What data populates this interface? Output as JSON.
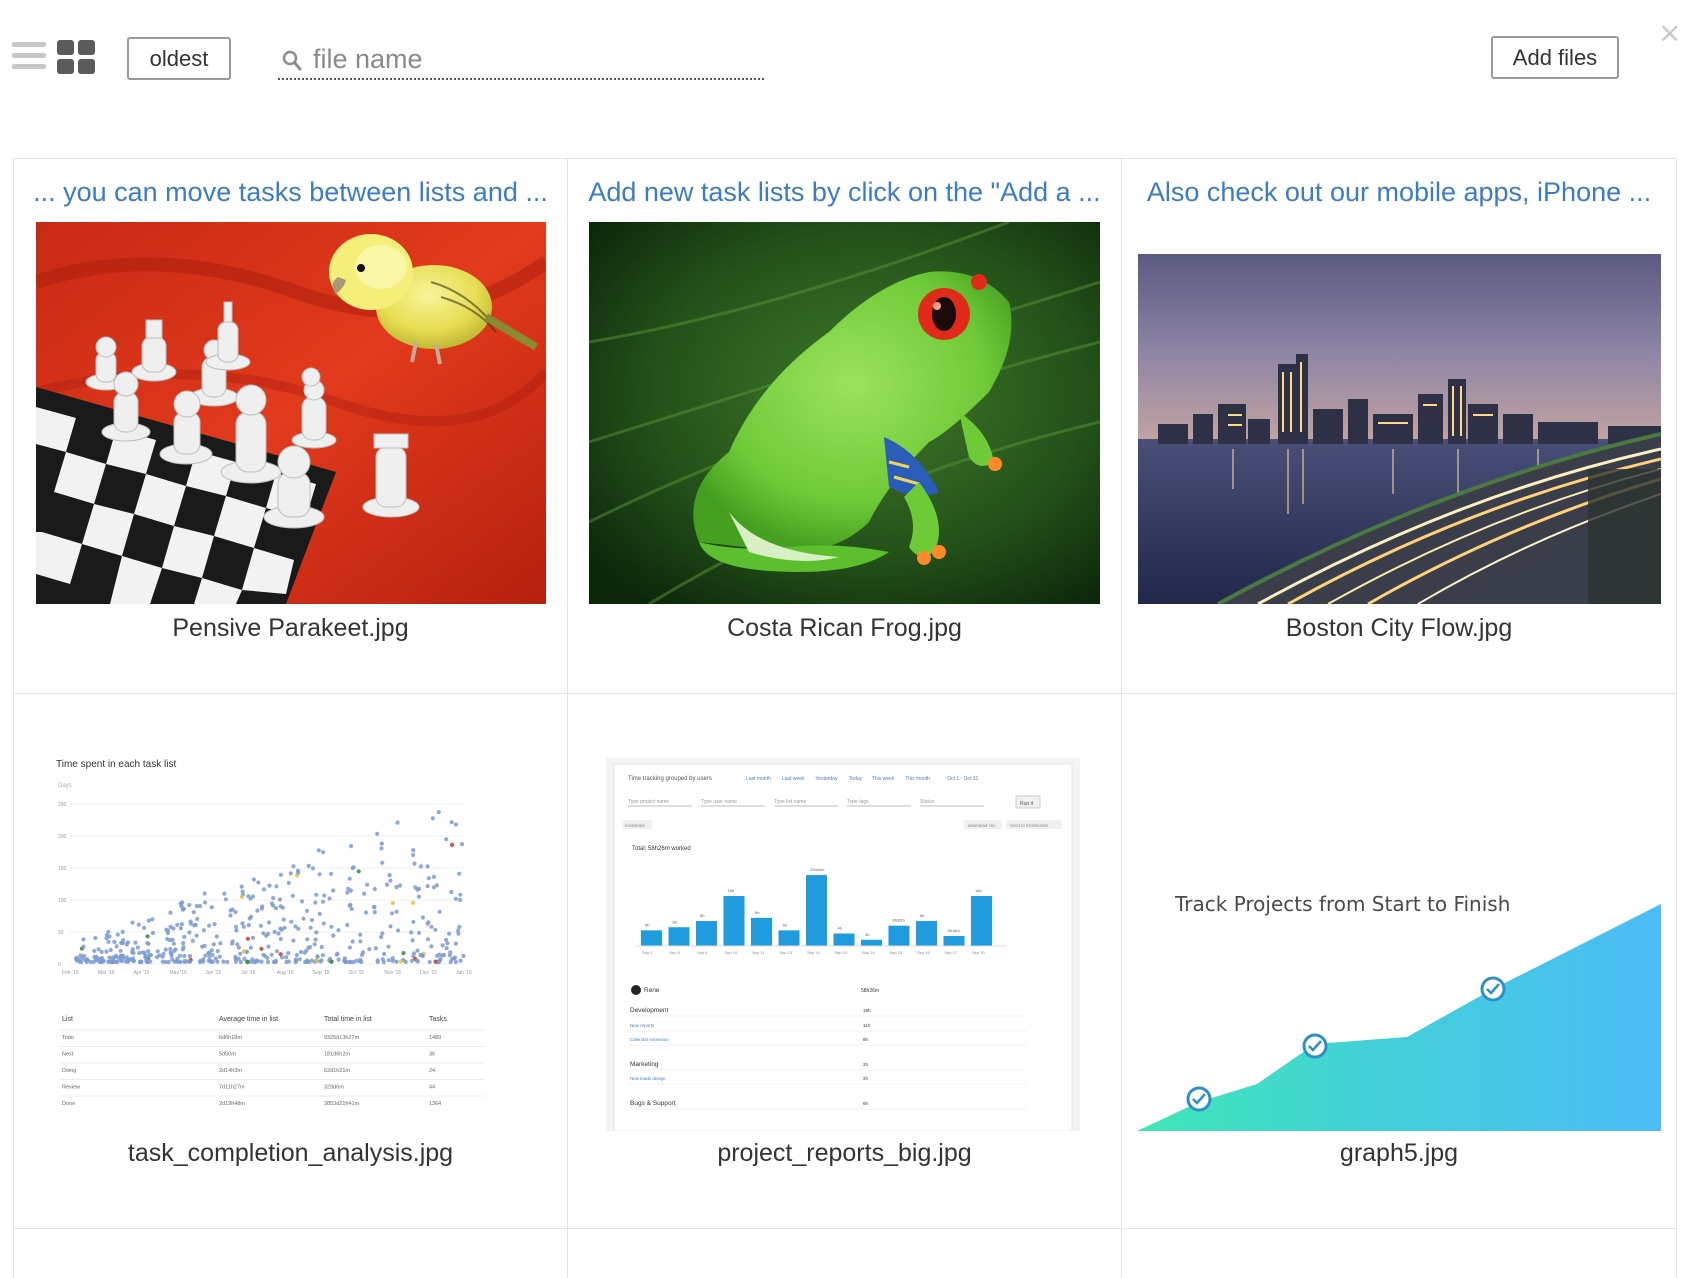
{
  "toolbar": {
    "sort_label": "oldest",
    "search_placeholder": "file name",
    "add_files_label": "Add files",
    "close_glyph": "×"
  },
  "files": [
    {
      "title": "... you can move tasks between lists and ...",
      "name": "Pensive Parakeet.jpg",
      "thumb": "parakeet-chess-photo"
    },
    {
      "title": "Add new task lists by click on the \"Add a ...",
      "name": "Costa Rican Frog.jpg",
      "thumb": "green-frog-photo"
    },
    {
      "title": "Also check out our mobile apps, iPhone ...",
      "name": "Boston City Flow.jpg",
      "thumb": "boston-skyline-photo"
    },
    {
      "title": "",
      "name": "task_completion_analysis.jpg",
      "thumb": "scatter-report-screenshot"
    },
    {
      "title": "",
      "name": "project_reports_big.jpg",
      "thumb": "bar-report-screenshot"
    },
    {
      "title": "",
      "name": "graph5.jpg",
      "thumb": "area-graph-image"
    }
  ],
  "thumb_text": {
    "scatter": {
      "title": "Time spent in each task list",
      "axis_unit": "Days",
      "y_ticks": [
        "250",
        "200",
        "150",
        "100",
        "50",
        "0"
      ],
      "x_ticks": [
        "Feb '15",
        "Mar '15",
        "Apr '15",
        "May '15",
        "Jun '15",
        "Jul '15",
        "Aug '15",
        "Sep '15",
        "Oct '15",
        "Nov '15",
        "Dec '15",
        "Jan '16"
      ],
      "table_headers": [
        "List",
        "Average time in list",
        "Total time in list",
        "Tasks"
      ],
      "table_rows": [
        [
          "Todo",
          "6d6h18m",
          "9325d13h27m",
          "1489"
        ],
        [
          "Next",
          "5d50m",
          "181d6h2m",
          "36"
        ],
        [
          "Doing",
          "2d14h3m",
          "62d1h21m",
          "24"
        ],
        [
          "Review",
          "7d11h27m",
          "329d6m",
          "44"
        ],
        [
          "Done",
          "2d19h48m",
          "3853d21h41m",
          "1364"
        ]
      ]
    },
    "bars": {
      "header": "Time tracking grouped by users",
      "filters": [
        "Last month",
        "Last week",
        "Yesterday",
        "Today",
        "This week",
        "This month"
      ],
      "date_range": "Oct 1 - Oct 31",
      "inputs": [
        "Type project name",
        "Type user name",
        "Type list name",
        "Type tags",
        "Status"
      ],
      "run_label": "Run it",
      "bookmark_label": "bookmark",
      "download_label": "download csv",
      "send_label": "send to freshbooks",
      "total": "Total: 58h26m worked",
      "bar_labels": [
        "5h",
        "6h",
        "8h",
        "16h",
        "9h",
        "5h",
        "22h41m",
        "4h",
        "2h",
        "6h32m",
        "8h",
        "3h14m",
        "16h"
      ],
      "bar_values": [
        5,
        6,
        8,
        16,
        9,
        5,
        22.7,
        4,
        2,
        6.5,
        8,
        3.2,
        16
      ],
      "x_ticks": [
        "Sep 2",
        "Sep 5",
        "Sep 6",
        "Sep 10",
        "Sep 11",
        "Sep 13",
        "Sep 14",
        "Sep 15",
        "Sep 24",
        "Sep 25",
        "Sep 26",
        "Sep 27",
        "Sep 30"
      ],
      "user": "Rene",
      "user_total": "58h26m",
      "rows": [
        [
          "Development",
          "19h"
        ],
        [
          "New reports",
          "11h"
        ],
        [
          "Calendar extension",
          "8h"
        ],
        [
          "Marketing",
          "2h"
        ],
        [
          "New leads design",
          "2h"
        ],
        [
          "Bugs & Support",
          "6h"
        ]
      ]
    },
    "graph": {
      "title": "Track Projects from Start to Finish"
    }
  }
}
